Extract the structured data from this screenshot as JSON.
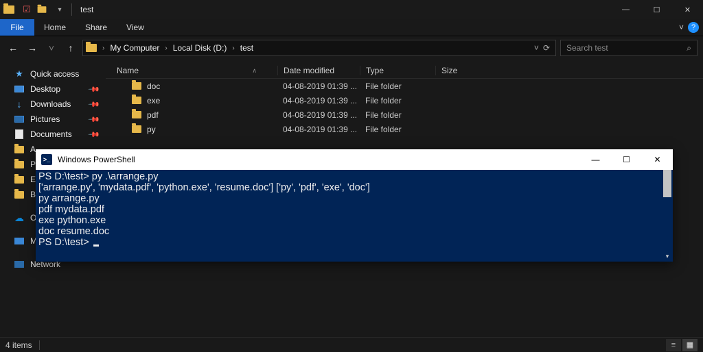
{
  "window": {
    "title": "test",
    "min": "—",
    "max": "☐",
    "close": "✕"
  },
  "ribbon": {
    "file": "File",
    "tabs": [
      "Home",
      "Share",
      "View"
    ],
    "chevron": "˅",
    "help": "?"
  },
  "nav": {
    "back": "←",
    "forward": "→",
    "dropdown": "˅",
    "up": "↑",
    "crumbs": [
      "My Computer",
      "Local Disk (D:)",
      "test"
    ],
    "refresh": "⟳",
    "addr_drop": "˅",
    "search_placeholder": "Search test",
    "search_icon": "⌕"
  },
  "sidebar": {
    "quick": "Quick access",
    "desktop": "Desktop",
    "downloads": "Downloads",
    "pictures": "Pictures",
    "documents": "Documents",
    "trunc_a": "A",
    "trunc_p": "P",
    "trunc_e": "E",
    "trunc_b": "B",
    "onedrive": "On",
    "thispc": "My",
    "network": "Network"
  },
  "columns": {
    "name": "Name",
    "date": "Date modified",
    "type": "Type",
    "size": "Size"
  },
  "files": [
    {
      "name": "doc",
      "date": "04-08-2019 01:39 ...",
      "type": "File folder",
      "size": ""
    },
    {
      "name": "exe",
      "date": "04-08-2019 01:39 ...",
      "type": "File folder",
      "size": ""
    },
    {
      "name": "pdf",
      "date": "04-08-2019 01:39 ...",
      "type": "File folder",
      "size": ""
    },
    {
      "name": "py",
      "date": "04-08-2019 01:39 ...",
      "type": "File folder",
      "size": ""
    }
  ],
  "status": {
    "count": "4 items"
  },
  "powershell": {
    "title": "Windows PowerShell",
    "icon": ">_",
    "min": "—",
    "max": "☐",
    "close": "✕",
    "lines": [
      "PS D:\\test> py .\\arrange.py",
      "['arrange.py', 'mydata.pdf', 'python.exe', 'resume.doc'] ['py', 'pdf', 'exe', 'doc']",
      "py arrange.py",
      "pdf mydata.pdf",
      "exe python.exe",
      "doc resume.doc",
      "PS D:\\test> "
    ]
  }
}
